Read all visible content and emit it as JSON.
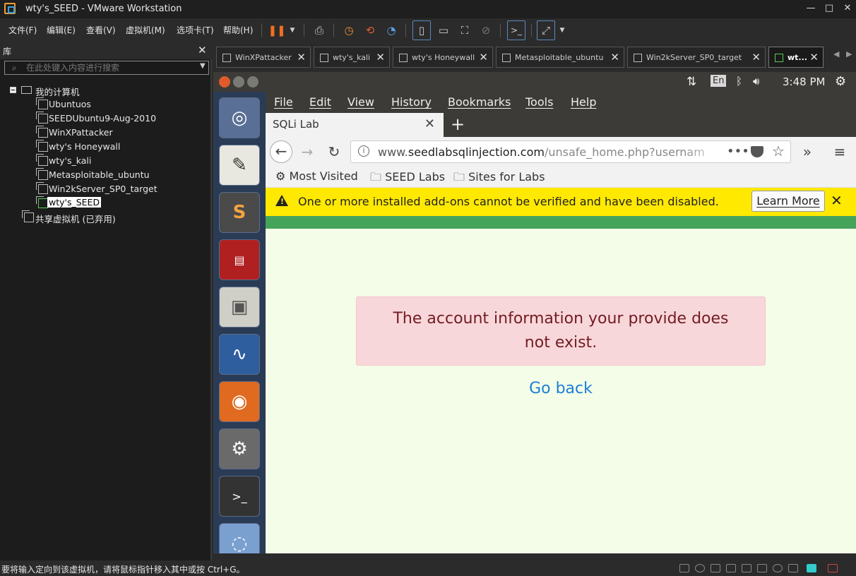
{
  "window": {
    "title": "wty's_SEED - VMware Workstation",
    "minimize": "—",
    "maximize": "□",
    "close": "✕"
  },
  "menu": [
    "文件(F)",
    "编辑(E)",
    "查看(V)",
    "虚拟机(M)",
    "选项卡(T)",
    "帮助(H)"
  ],
  "library": {
    "title": "库",
    "close": "✕",
    "search_placeholder": "在此处键入内容进行搜索",
    "root": "我的计算机",
    "items": [
      "Ubuntuos",
      "SEEDUbuntu9-Aug-2010",
      "WinXPattacker",
      "wty's Honeywall",
      "wty's_kali",
      "Metasploitable_ubuntu",
      "Win2kServer_SP0_target",
      "wty's_SEED"
    ],
    "shared": "共享虚拟机 (已弃用)"
  },
  "vm_tabs": [
    "WinXPattacker",
    "wty's_kali",
    "wty's Honeywall",
    "Metasploitable_ubuntu",
    "Win2kServer_SP0_target",
    "wt..."
  ],
  "ubuntu": {
    "keyboard": "En",
    "time": "3:48 PM"
  },
  "firefox": {
    "menu": [
      "File",
      "Edit",
      "View",
      "History",
      "Bookmarks",
      "Tools",
      "Help"
    ],
    "tab_title": "SQLi Lab",
    "url_host": "www.",
    "url_domain": "seedlabsqlinjection.com",
    "url_path": "/unsafe_home.php?usernam",
    "bookmarks": [
      "Most Visited",
      "SEED Labs",
      "Sites for Labs"
    ],
    "notice": "One or more installed add-ons cannot be verified and have been disabled.",
    "learn_more": "Learn More",
    "alert_line1": "The account information your provide does",
    "alert_line2": "not exist.",
    "go_back": "Go back"
  },
  "status": "要将输入定向到该虚拟机，请将鼠标指针移入其中或按 Ctrl+G。"
}
